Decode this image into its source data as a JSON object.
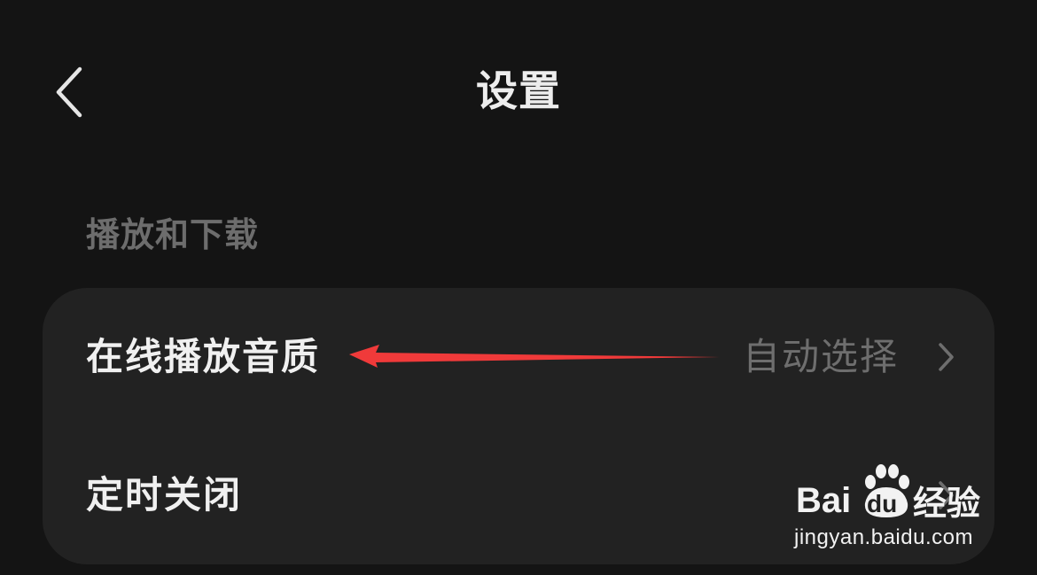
{
  "header": {
    "back_icon": "chevron-left-icon",
    "title": "设置"
  },
  "section": {
    "title": "播放和下载"
  },
  "settings": [
    {
      "label": "在线播放音质",
      "value": "自动选择",
      "icon": "chevron-right-icon"
    },
    {
      "label": "定时关闭",
      "value": "",
      "icon": "chevron-right-icon"
    }
  ],
  "colors": {
    "background": "#141414",
    "card": "#222222",
    "title_text": "#ededed",
    "section_text": "#6d6d6d",
    "value_text": "#6e6e6e",
    "annotation_arrow": "#f03a3a"
  },
  "watermark": {
    "brand_bai": "Bai",
    "brand_du": "du",
    "brand_suffix": "经验",
    "url": "jingyan.baidu.com"
  }
}
